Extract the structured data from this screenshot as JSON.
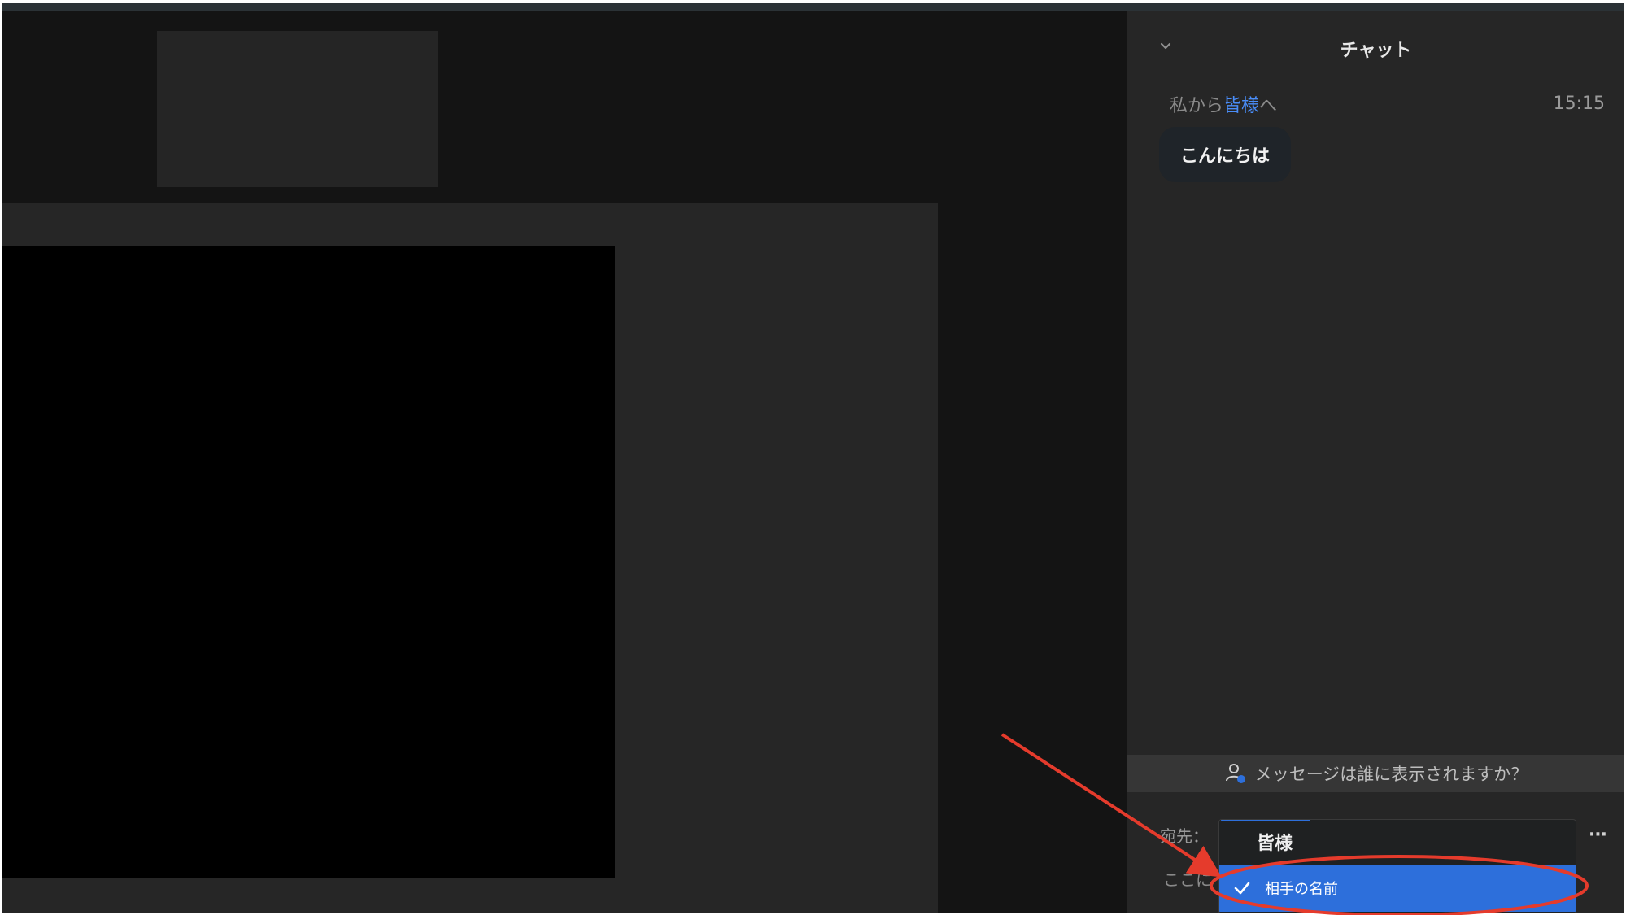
{
  "chat": {
    "title": "チャット",
    "message": {
      "from_prefix": "私から",
      "to_name": "皆様",
      "to_suffix": "へ",
      "time": "15:15",
      "text": "こんにちは"
    },
    "visibility_prompt": "メッセージは誰に表示されますか？",
    "recipient_label": "宛先：",
    "input_placeholder": "ここに",
    "more_label": "···",
    "dropdown": {
      "options": [
        {
          "label": "皆様",
          "selected": false
        },
        {
          "label": "相手の名前",
          "selected": true
        }
      ]
    }
  },
  "colors": {
    "accent": "#2d6fdb",
    "link": "#4a8df8",
    "annotation": "#e53b2c"
  },
  "icons": {
    "collapse": "chevron-down-icon",
    "visibility": "person-icon",
    "check": "checkmark-icon",
    "more": "more-icon"
  }
}
